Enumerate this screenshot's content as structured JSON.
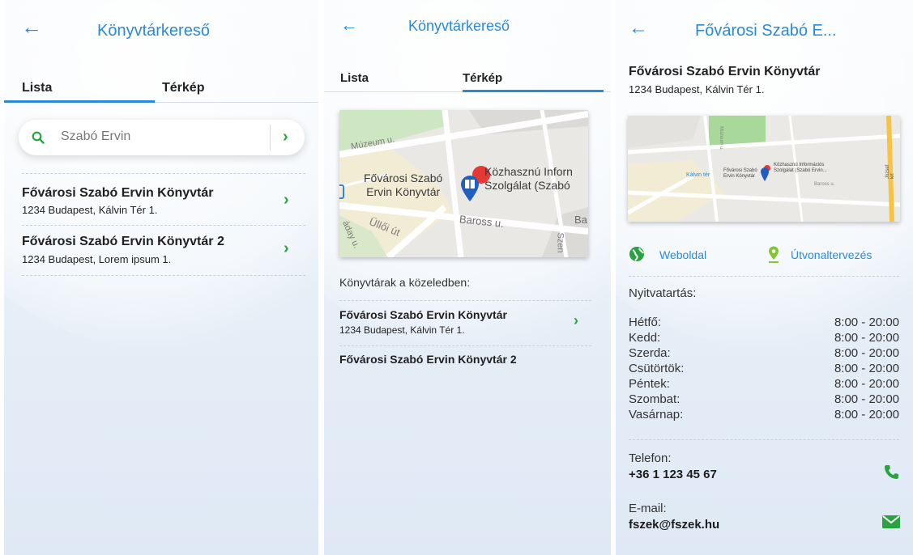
{
  "panel1": {
    "title": "Könyvtárkereső",
    "tabs": [
      "Lista",
      "Térkép"
    ],
    "search_value": "Szabó Ervin",
    "results": [
      {
        "name": "Fővárosi Szabó Ervin Könyvtár",
        "address": "1234 Budapest, Kálvin Tér 1."
      },
      {
        "name": "Fővárosi Szabó Ervin Könyvtár 2",
        "address": "1234 Budapest, Lorem ipsum 1."
      }
    ]
  },
  "panel2": {
    "title": "Könyvtárkereső",
    "tabs": [
      "Lista",
      "Térkép"
    ],
    "map_labels": {
      "museum_street": "Múzeum u.",
      "library_line1": "Fővárosi Szabó",
      "library_line2": "Ervin Könyvtár",
      "info_line1": "Közhasznú Inforn",
      "info_line2": "Szolgálat (Szabó",
      "ulloi": "Üllői út",
      "baross": "Baross u.",
      "ba": "Ba",
      "szen": "Szen",
      "aday": "áday u."
    },
    "nearby_heading": "Könyvtárak a közeledben:",
    "results": [
      {
        "name": "Fővárosi Szabó Ervin Könyvtár",
        "address": "1234 Budapest, Kálvin Tér 1."
      },
      {
        "name": "Fővárosi Szabó Ervin Könyvtár 2",
        "address": ""
      }
    ]
  },
  "panel3": {
    "title": "Fővárosi Szabó E...",
    "name": "Fővárosi Szabó Ervin Könyvtár",
    "address": "1234 Budapest, Kálvin Tér 1.",
    "map_labels": {
      "kalvin": "Kálvin tér",
      "library": "Fővárosi Szabó Ervin Könyvtár",
      "info": "Közhasznú Információs Szolgálat (Szabó Ervin...",
      "museum": "Múzeum u.",
      "baross": "Baross u.",
      "jozsef": "József krt"
    },
    "website_label": "Weboldal",
    "route_label": "Útvonaltervezés",
    "opening_heading": "Nyitvatartás:",
    "hours": [
      {
        "day": "Hétfő:",
        "time": "8:00 - 20:00"
      },
      {
        "day": "Kedd:",
        "time": "8:00 - 20:00"
      },
      {
        "day": "Szerda:",
        "time": "8:00 - 20:00"
      },
      {
        "day": "Csütörtök:",
        "time": "8:00 - 20:00"
      },
      {
        "day": "Péntek:",
        "time": "8:00 - 20:00"
      },
      {
        "day": "Szombat:",
        "time": "8:00 - 20:00"
      },
      {
        "day": "Vasárnap:",
        "time": "8:00 - 20:00"
      }
    ],
    "phone_label": "Telefon:",
    "phone_value": "+36 1 123 45 67",
    "email_label": "E-mail:",
    "email_value": "fszek@fszek.hu"
  },
  "colors": {
    "accent": "#2a8ad8",
    "green": "#2aa23f",
    "map_pin": "#1f5fc4",
    "pin_red": "#e53935"
  }
}
